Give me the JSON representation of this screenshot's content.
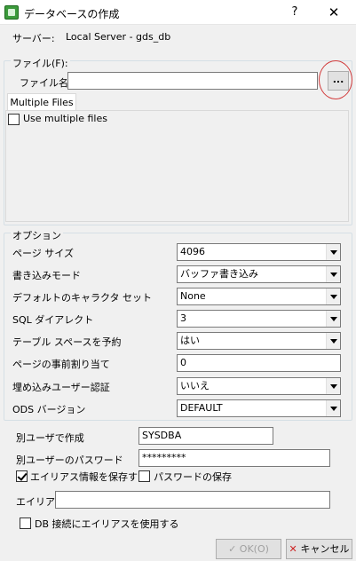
{
  "window": {
    "title": "データベースの作成",
    "help": "?",
    "close": "✕"
  },
  "server": {
    "label": "サーバー:",
    "value": "Local Server - gds_db"
  },
  "file_group": {
    "legend": "ファイル(F):",
    "filename_label": "ファイル名",
    "filename_value": "",
    "browse_label": "...",
    "tab_label": "Multiple Files",
    "use_multiple_label": "Use multiple files"
  },
  "options": {
    "legend": "オプション",
    "rows": [
      {
        "label": "ページ サイズ",
        "value": "4096",
        "kind": "select"
      },
      {
        "label": "書き込みモード",
        "value": "バッファ書き込み",
        "kind": "select"
      },
      {
        "label": "デフォルトのキャラクタ セット",
        "value": "None",
        "kind": "select"
      },
      {
        "label": "SQL ダイアレクト",
        "value": "3",
        "kind": "select"
      },
      {
        "label": "テーブル スペースを予約",
        "value": "はい",
        "kind": "select"
      },
      {
        "label": "ページの事前割り当て",
        "value": "0",
        "kind": "input"
      },
      {
        "label": "埋め込みユーザー認証",
        "value": "いいえ",
        "kind": "select"
      },
      {
        "label": "ODS バージョン",
        "value": "DEFAULT",
        "kind": "select"
      }
    ]
  },
  "user": {
    "create_as_label": "別ユーザで作成",
    "create_as_value": "SYSDBA",
    "password_label": "別ユーザーのパスワード",
    "password_value": "*********",
    "save_alias_label": "エイリアス情報を保存する",
    "save_alias_checked": true,
    "save_password_label": "パスワードの保存",
    "save_password_checked": false,
    "alias_label": "エイリアス",
    "alias_value": "",
    "use_alias_label": "DB 接続にエイリアスを使用する",
    "use_alias_checked": false
  },
  "buttons": {
    "ok": "OK(O)",
    "cancel": "キャンセル"
  },
  "colors": {
    "window_bg": "#f0f0f0",
    "highlight_circle": "#d23a3a",
    "cancel_icon": "#cc2222",
    "ok_disabled_text": "#a0a0a0"
  }
}
